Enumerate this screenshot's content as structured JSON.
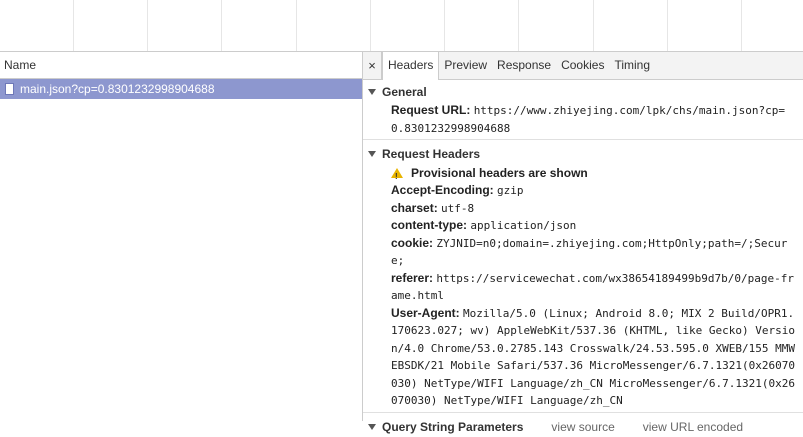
{
  "left_pane": {
    "header": "Name",
    "requests": [
      {
        "name": "main.json?cp=0.8301232998904688",
        "selected": true
      }
    ]
  },
  "tabs": {
    "close_glyph": "×",
    "items": [
      "Headers",
      "Preview",
      "Response",
      "Cookies",
      "Timing"
    ],
    "active": "Headers"
  },
  "general": {
    "title": "General",
    "request_url_label": "Request URL:",
    "request_url_value": "https://www.zhiyejing.com/lpk/chs/main.json?cp=0.8301232998904688"
  },
  "request_headers": {
    "title": "Request Headers",
    "warning": "Provisional headers are shown",
    "items": [
      {
        "key": "Accept-Encoding:",
        "value": "gzip"
      },
      {
        "key": "charset:",
        "value": "utf-8"
      },
      {
        "key": "content-type:",
        "value": "application/json"
      },
      {
        "key": "cookie:",
        "value": "ZYJNID=n0;domain=.zhiyejing.com;HttpOnly;path=/;Secure;"
      },
      {
        "key": "referer:",
        "value": "https://servicewechat.com/wx38654189499b9d7b/0/page-frame.html"
      },
      {
        "key": "User-Agent:",
        "value": "Mozilla/5.0 (Linux; Android 8.0; MIX 2 Build/OPR1.170623.027; wv) AppleWebKit/537.36 (KHTML, like Gecko) Version/4.0 Chrome/53.0.2785.143 Crosswalk/24.53.595.0 XWEB/155 MMWEBSDK/21 Mobile Safari/537.36 MicroMessenger/6.7.1321(0x26070030) NetType/WIFI Language/zh_CN MicroMessenger/6.7.1321(0x26070030) NetType/WIFI Language/zh_CN"
      }
    ]
  },
  "query_string": {
    "title": "Query String Parameters",
    "view_source": "view source",
    "view_url_encoded": "view URL encoded"
  },
  "colors": {
    "selection": "#8d97cf",
    "warning": "#e8b400",
    "border": "#cccccc"
  }
}
